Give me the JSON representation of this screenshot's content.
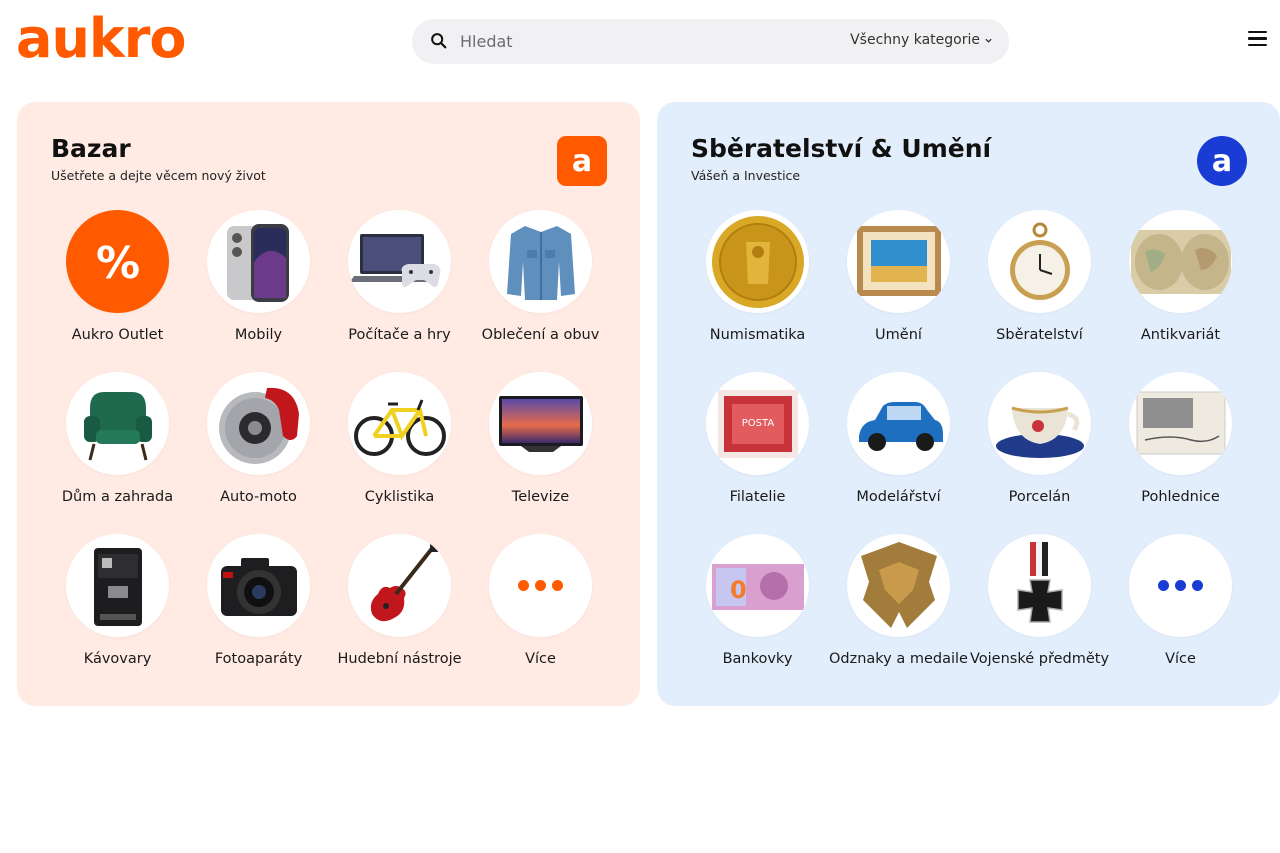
{
  "header": {
    "logo": "aukro",
    "search_placeholder": "Hledat",
    "category_select": "Všechny kategorie",
    "menu_icon": "hamburger-menu-icon"
  },
  "colors": {
    "brand_orange": "#ff5a00",
    "brand_blue": "#1a3bd4",
    "bazar_bg": "#ffebe3",
    "sber_bg": "#e3eefc"
  },
  "bazar": {
    "title": "Bazar",
    "subtitle": "Ušetřete a dejte věcem nový život",
    "logo_letter": "a",
    "items": [
      {
        "label": "Aukro Outlet",
        "icon": "percent-icon"
      },
      {
        "label": "Mobily",
        "icon": "smartphone-icon"
      },
      {
        "label": "Počítače a hry",
        "icon": "laptop-gamepad-icon"
      },
      {
        "label": "Oblečení a obuv",
        "icon": "denim-jacket-icon"
      },
      {
        "label": "Dům a zahrada",
        "icon": "armchair-icon"
      },
      {
        "label": "Auto-moto",
        "icon": "brake-disc-icon"
      },
      {
        "label": "Cyklistika",
        "icon": "bicycle-icon"
      },
      {
        "label": "Televize",
        "icon": "television-icon"
      },
      {
        "label": "Kávovary",
        "icon": "coffee-machine-icon"
      },
      {
        "label": "Fotoaparáty",
        "icon": "camera-icon"
      },
      {
        "label": "Hudební nástroje",
        "icon": "electric-guitar-icon"
      },
      {
        "label": "Více",
        "icon": "more-dots-icon"
      }
    ]
  },
  "sber": {
    "title": "Sběratelství & Umění",
    "subtitle": "Vášeň a Investice",
    "logo_letter": "a",
    "items": [
      {
        "label": "Numismatika",
        "icon": "gold-coin-icon"
      },
      {
        "label": "Umění",
        "icon": "framed-painting-icon"
      },
      {
        "label": "Sběratelství",
        "icon": "pocket-watch-icon"
      },
      {
        "label": "Antikvariát",
        "icon": "old-map-icon"
      },
      {
        "label": "Filatelie",
        "icon": "postage-stamp-icon"
      },
      {
        "label": "Modelářství",
        "icon": "model-car-icon"
      },
      {
        "label": "Porcelán",
        "icon": "porcelain-cup-icon"
      },
      {
        "label": "Pohlednice",
        "icon": "postcard-icon"
      },
      {
        "label": "Bankovky",
        "icon": "banknote-icon"
      },
      {
        "label": "Odznaky a medaile",
        "icon": "badge-icon"
      },
      {
        "label": "Vojenské předměty",
        "icon": "iron-cross-medal-icon"
      },
      {
        "label": "Více",
        "icon": "more-dots-icon"
      }
    ]
  }
}
